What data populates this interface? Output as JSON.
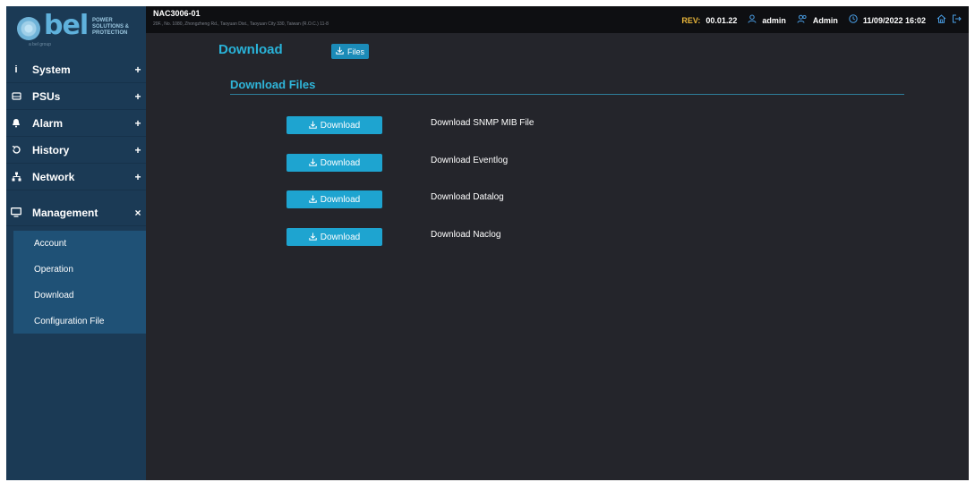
{
  "brand": {
    "logo_text": "bel",
    "logo_subtext": "POWER SOLUTIONS & PROTECTION",
    "group_text": "a bel group"
  },
  "header": {
    "device_name": "NAC3006-01",
    "device_address": "20F., No. 1080, Zhongzheng Rd., Taoyuan Dist., Taoyuan City 330, Taiwan (R.O.C.) 11-8",
    "rev_label": "REV:",
    "rev_value": "00.01.22",
    "user_name": "admin",
    "user_role": "Admin",
    "datetime": "11/09/2022 16:02",
    "accent_color": "#e8b53a",
    "icon_color": "#4aa0e8"
  },
  "sidebar": {
    "items": [
      {
        "label": "System",
        "icon": "info-icon",
        "toggle": "+"
      },
      {
        "label": "PSUs",
        "icon": "psu-icon",
        "toggle": "+"
      },
      {
        "label": "Alarm",
        "icon": "bell-icon",
        "toggle": "+"
      },
      {
        "label": "History",
        "icon": "history-icon",
        "toggle": "+"
      },
      {
        "label": "Network",
        "icon": "network-icon",
        "toggle": "+"
      },
      {
        "label": "Management",
        "icon": "monitor-icon",
        "toggle": "×"
      }
    ],
    "submenu": [
      {
        "label": "Account"
      },
      {
        "label": "Operation"
      },
      {
        "label": "Download"
      },
      {
        "label": "Configuration File"
      }
    ]
  },
  "main": {
    "page_title": "Download",
    "files_button_label": "Files",
    "section_title": "Download Files",
    "downloads": [
      {
        "button_label": "Download",
        "text": "Download SNMP MIB File"
      },
      {
        "button_label": "Download",
        "text": "Download Eventlog"
      },
      {
        "button_label": "Download",
        "text": "Download Datalog"
      },
      {
        "button_label": "Download",
        "text": "Download Naclog"
      }
    ],
    "accent_color": "#29b3d9",
    "button_color": "#1ea4d0"
  }
}
